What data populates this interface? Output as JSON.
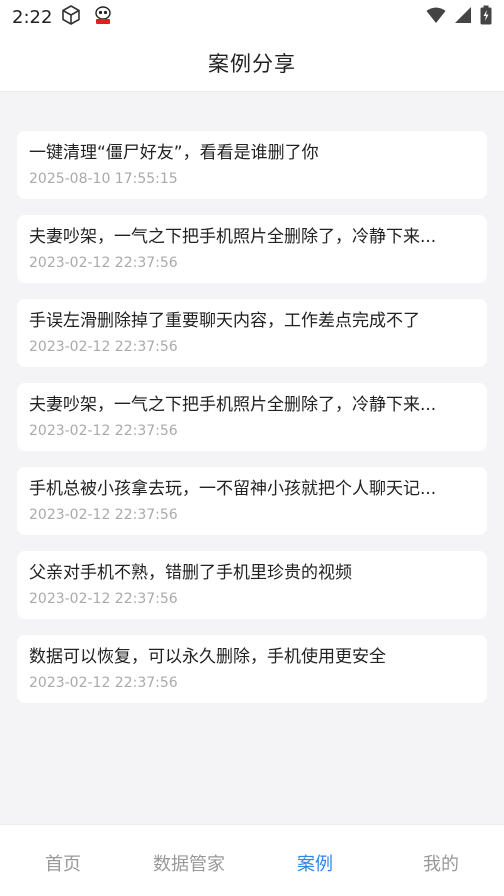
{
  "status_bar": {
    "time": "2:22",
    "icons": [
      "box-icon",
      "app-notification-icon",
      "wifi-icon",
      "signal-icon",
      "battery-icon"
    ]
  },
  "header": {
    "title": "案例分享"
  },
  "cases": [
    {
      "title": "一键清理“僵尸好友”，看看是谁删了你",
      "date": "2025-08-10 17:55:15"
    },
    {
      "title": "夫妻吵架，一气之下把手机照片全删除了，冷静下来...",
      "date": "2023-02-12 22:37:56"
    },
    {
      "title": "手误左滑删除掉了重要聊天内容，工作差点完成不了",
      "date": "2023-02-12 22:37:56"
    },
    {
      "title": "夫妻吵架，一气之下把手机照片全删除了，冷静下来...",
      "date": "2023-02-12 22:37:56"
    },
    {
      "title": "手机总被小孩拿去玩，一不留神小孩就把个人聊天记...",
      "date": "2023-02-12 22:37:56"
    },
    {
      "title": "父亲对手机不熟，错删了手机里珍贵的视频",
      "date": "2023-02-12 22:37:56"
    },
    {
      "title": "数据可以恢复，可以永久删除，手机使用更安全",
      "date": "2023-02-12 22:37:56"
    }
  ],
  "bottom_nav": {
    "active": "案例",
    "items": [
      {
        "label": "首页"
      },
      {
        "label": "数据管家"
      },
      {
        "label": "案例"
      },
      {
        "label": "我的"
      }
    ]
  },
  "colors": {
    "accent": "#2f86e8",
    "background": "#f4f4f6",
    "card": "#ffffff",
    "muted_text": "#aaaaaa"
  }
}
